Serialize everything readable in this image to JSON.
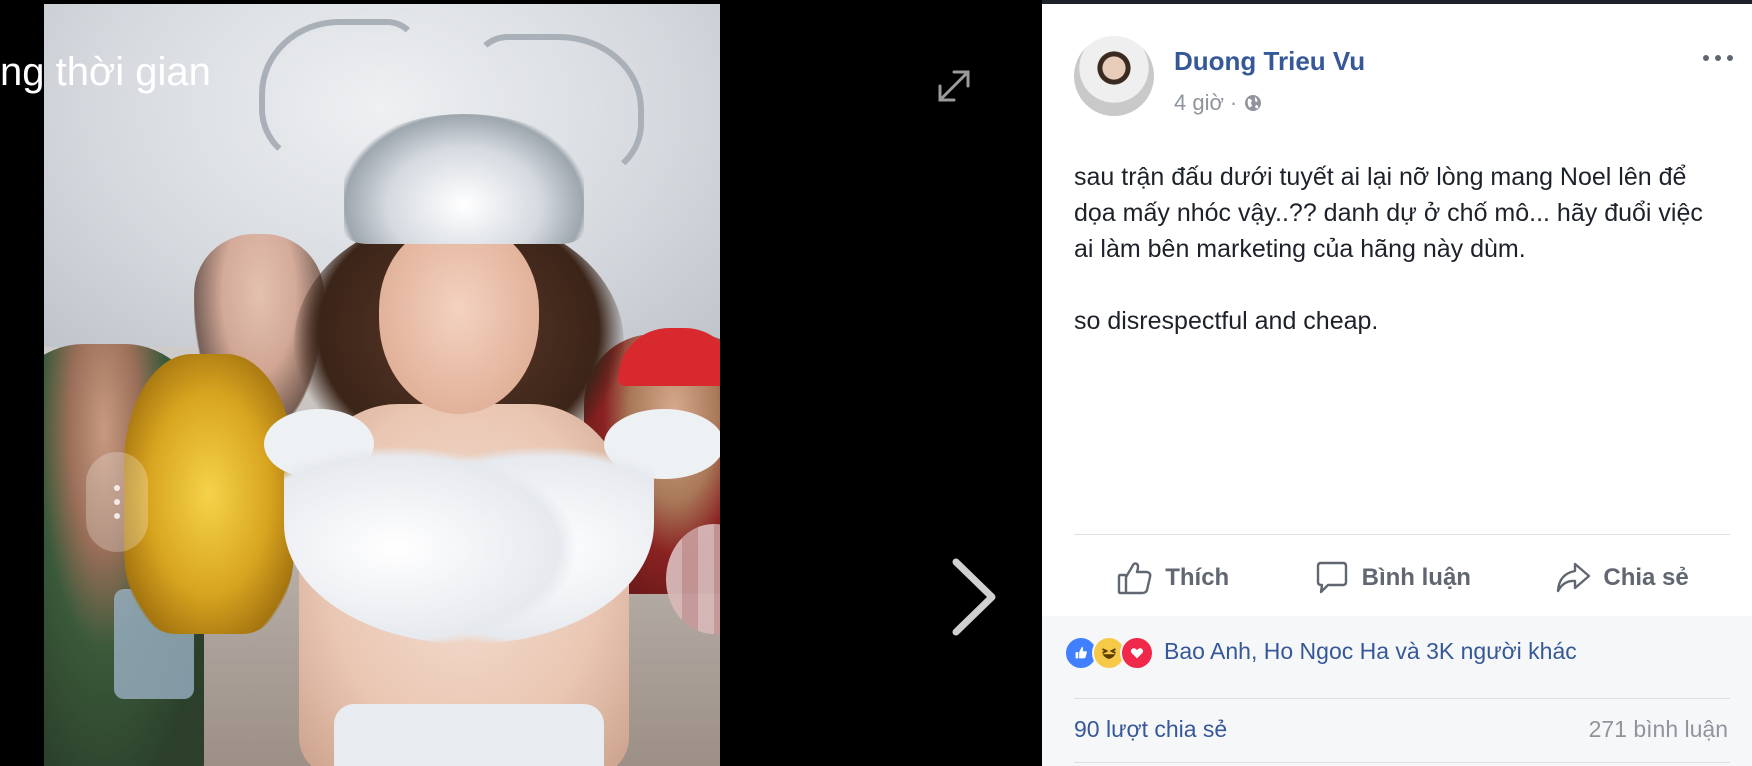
{
  "theater": {
    "caption": "ng thời gian"
  },
  "post": {
    "author": "Duong Trieu Vu",
    "time": "4 giờ",
    "separator": "·",
    "text_paragraphs": [
      "sau trận đấu dưới tuyết ai lại nỡ lòng mang Noel lên để dọa mấy nhóc vậy..?? danh dự ở chố mô... hãy đuổi việc ai làm bên marketing của hãng này dùm.",
      "so disrespectful and cheap."
    ],
    "actions": {
      "like": "Thích",
      "comment": "Bình luận",
      "share": "Chia sẻ"
    },
    "reactions": {
      "icons": [
        "like-reaction",
        "haha-reaction",
        "love-reaction"
      ],
      "names": "Bao Anh, Ho Ngoc Ha và 3K người khác"
    },
    "shares": "90 lượt chia sẻ",
    "comments": "271 bình luận"
  },
  "colors": {
    "link": "#365899",
    "muted": "#90949c",
    "text": "#1d2129",
    "like": "#4080ff",
    "love": "#f0284a",
    "haha": "#f7c948"
  }
}
